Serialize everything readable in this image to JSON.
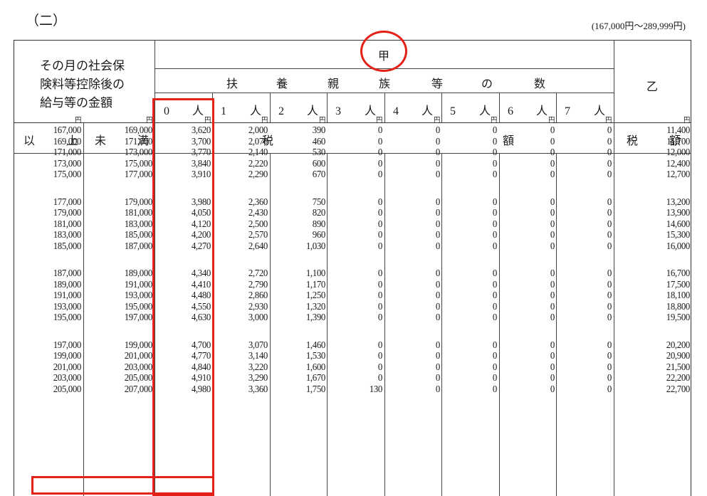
{
  "page": {
    "heading": "（二）",
    "range": "(167,000円～289,999円)"
  },
  "header": {
    "caption_lines": [
      "その月の社会保",
      "険料等控除後の",
      "給与等の金額"
    ],
    "ko": "甲",
    "fuyou_chars": [
      "扶",
      "養",
      "親",
      "族",
      "等",
      "の",
      "数"
    ],
    "otsu": "乙",
    "dependents": [
      {
        "n": "0",
        "unit": "人"
      },
      {
        "n": "1",
        "unit": "人"
      },
      {
        "n": "2",
        "unit": "人"
      },
      {
        "n": "3",
        "unit": "人"
      },
      {
        "n": "4",
        "unit": "人"
      },
      {
        "n": "5",
        "unit": "人"
      },
      {
        "n": "6",
        "unit": "人"
      },
      {
        "n": "7",
        "unit": "人"
      }
    ],
    "ijou": [
      "以",
      "上"
    ],
    "miman": [
      "未",
      "満"
    ],
    "zei": "税",
    "gaku": "額",
    "otsu_zeigaku": [
      "税",
      "額"
    ],
    "yen": "円"
  },
  "colors": {
    "highlight": "#e32119",
    "rule": "#333333"
  },
  "rows": [
    [
      "167,000",
      "169,000",
      "3,620",
      "2,000",
      "390",
      "0",
      "0",
      "0",
      "0",
      "0",
      "11,400"
    ],
    [
      "169,000",
      "171,000",
      "3,700",
      "2,070",
      "460",
      "0",
      "0",
      "0",
      "0",
      "0",
      "11,700"
    ],
    [
      "171,000",
      "173,000",
      "3,770",
      "2,140",
      "530",
      "0",
      "0",
      "0",
      "0",
      "0",
      "12,000"
    ],
    [
      "173,000",
      "175,000",
      "3,840",
      "2,220",
      "600",
      "0",
      "0",
      "0",
      "0",
      "0",
      "12,400"
    ],
    [
      "175,000",
      "177,000",
      "3,910",
      "2,290",
      "670",
      "0",
      "0",
      "0",
      "0",
      "0",
      "12,700"
    ],
    [
      "177,000",
      "179,000",
      "3,980",
      "2,360",
      "750",
      "0",
      "0",
      "0",
      "0",
      "0",
      "13,200"
    ],
    [
      "179,000",
      "181,000",
      "4,050",
      "2,430",
      "820",
      "0",
      "0",
      "0",
      "0",
      "0",
      "13,900"
    ],
    [
      "181,000",
      "183,000",
      "4,120",
      "2,500",
      "890",
      "0",
      "0",
      "0",
      "0",
      "0",
      "14,600"
    ],
    [
      "183,000",
      "185,000",
      "4,200",
      "2,570",
      "960",
      "0",
      "0",
      "0",
      "0",
      "0",
      "15,300"
    ],
    [
      "185,000",
      "187,000",
      "4,270",
      "2,640",
      "1,030",
      "0",
      "0",
      "0",
      "0",
      "0",
      "16,000"
    ],
    [
      "187,000",
      "189,000",
      "4,340",
      "2,720",
      "1,100",
      "0",
      "0",
      "0",
      "0",
      "0",
      "16,700"
    ],
    [
      "189,000",
      "191,000",
      "4,410",
      "2,790",
      "1,170",
      "0",
      "0",
      "0",
      "0",
      "0",
      "17,500"
    ],
    [
      "191,000",
      "193,000",
      "4,480",
      "2,860",
      "1,250",
      "0",
      "0",
      "0",
      "0",
      "0",
      "18,100"
    ],
    [
      "193,000",
      "195,000",
      "4,550",
      "2,930",
      "1,320",
      "0",
      "0",
      "0",
      "0",
      "0",
      "18,800"
    ],
    [
      "195,000",
      "197,000",
      "4,630",
      "3,000",
      "1,390",
      "0",
      "0",
      "0",
      "0",
      "0",
      "19,500"
    ],
    [
      "197,000",
      "199,000",
      "4,700",
      "3,070",
      "1,460",
      "0",
      "0",
      "0",
      "0",
      "0",
      "20,200"
    ],
    [
      "199,000",
      "201,000",
      "4,770",
      "3,140",
      "1,530",
      "0",
      "0",
      "0",
      "0",
      "0",
      "20,900"
    ],
    [
      "201,000",
      "203,000",
      "4,840",
      "3,220",
      "1,600",
      "0",
      "0",
      "0",
      "0",
      "0",
      "21,500"
    ],
    [
      "203,000",
      "205,000",
      "4,910",
      "3,290",
      "1,670",
      "0",
      "0",
      "0",
      "0",
      "0",
      "22,200"
    ],
    [
      "205,000",
      "207,000",
      "4,980",
      "3,360",
      "1,750",
      "130",
      "0",
      "0",
      "0",
      "0",
      "22,700"
    ]
  ]
}
